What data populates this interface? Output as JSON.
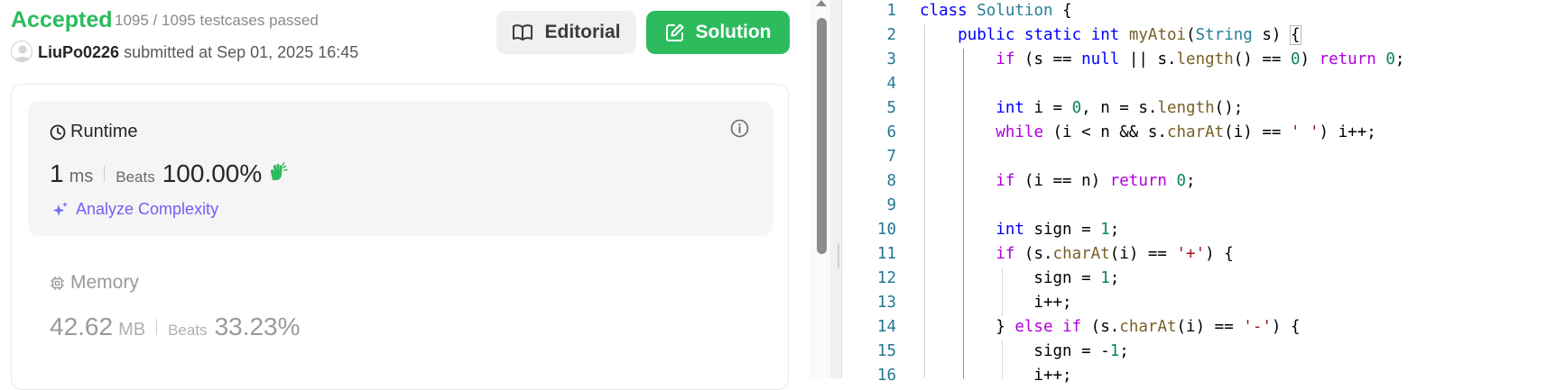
{
  "submission": {
    "status": "Accepted",
    "testcases": "1095 / 1095 testcases passed",
    "author": "LiuPo0226",
    "submitted_text": "submitted at Sep 01, 2025 16:45"
  },
  "buttons": {
    "editorial": "Editorial",
    "solution": "Solution"
  },
  "runtime": {
    "title": "Runtime",
    "value": "1",
    "unit": "ms",
    "beats_label": "Beats",
    "beats": "100.00%",
    "analyze": "Analyze Complexity"
  },
  "memory": {
    "title": "Memory",
    "value": "42.62",
    "unit": "MB",
    "beats_label": "Beats",
    "beats": "33.23%"
  },
  "editor": {
    "line_numbers": [
      "1",
      "2",
      "3",
      "4",
      "5",
      "6",
      "7",
      "8",
      "9",
      "10",
      "11",
      "12",
      "13",
      "14",
      "15",
      "16"
    ],
    "lines": [
      "class Solution {",
      "    public static int myAtoi(String s) {",
      "        if (s == null || s.length() == 0) return 0;",
      "",
      "        int i = 0, n = s.length();",
      "        while (i < n && s.charAt(i) == ' ') i++;",
      "",
      "        if (i == n) return 0;",
      "",
      "        int sign = 1;",
      "        if (s.charAt(i) == '+') {",
      "            sign = 1;",
      "            i++;",
      "        } else if (s.charAt(i) == '-') {",
      "            sign = -1;",
      "            i++;"
    ]
  },
  "colors": {
    "accent_green": "#2cbb5d",
    "analyze_purple": "#7a5af8",
    "line_number": "#237893"
  }
}
